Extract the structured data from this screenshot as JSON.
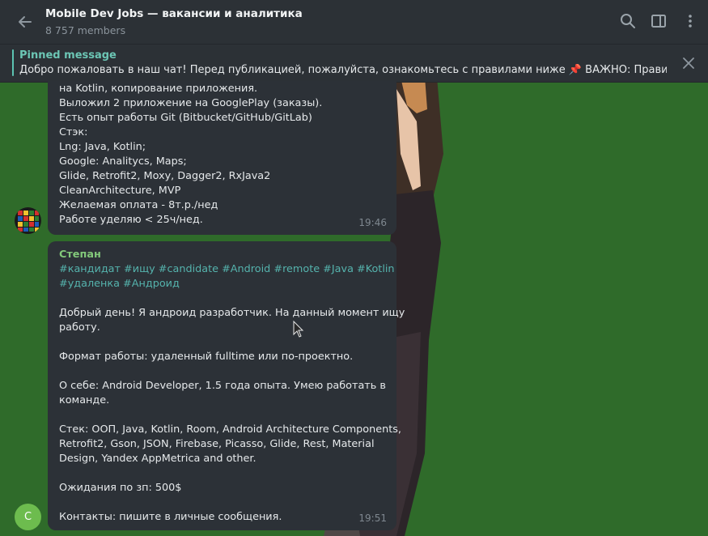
{
  "header": {
    "title": "Mobile Dev Jobs — вакансии и аналитика",
    "members": "8 757 members",
    "icons": [
      "back-arrow-icon",
      "search-icon",
      "sidebar-toggle-icon",
      "more-vertical-icon"
    ]
  },
  "pinned": {
    "label": "Pinned message",
    "text": "Добро пожаловать в наш чат! Перед публикацией, пожалуйста, ознакомьтесь с правилами ниже   📌 ВАЖНО: Правила пу..."
  },
  "messages": [
    {
      "lines": [
        "на Kotlin, копирование приложения.",
        "Выложил 2 приложение на GooglePlay (заказы).",
        "Есть опыт работы Git (Bitbucket/GitHub/GitLab)",
        "Стэк:",
        "Lng: Java, Kotlin;",
        "Google: Analitycs, Maps;",
        "Glide, Retrofit2, Moxy, Dagger2, RxJava2",
        "CleanArchitecture, MVP",
        "Желаемая оплата - 8т.р./нед",
        "Работе уделяю < 25ч/нед."
      ],
      "time": "19:46"
    },
    {
      "sender": "Степан",
      "avatar_letter": "С",
      "hashtags_line1": "#кандидат #ищу #candidate #Android #remote #Java #Kotlin",
      "hashtags_line2": "#удаленка #Андроид",
      "lines": [
        "",
        "Добрый день! Я андроид разработчик. На данный момент ищу",
        "работу.",
        "",
        "Формат работы: удаленный fulltime или по-проектно.",
        "",
        "О себе: Android Developer, 1.5 года опыта. Умею работать в",
        "команде.",
        "",
        "Стек: ООП, Java, Kotlin, Room, Android Architecture Components,",
        "Retrofit2, Gson, JSON, Firebase, Picasso, Glide, Rest, Material",
        "Design, Yandex AppMetrica and other.",
        "",
        "Ожидания по зп: 500$",
        "",
        "Контакты: пишите в личные сообщения."
      ],
      "time": "19:51"
    }
  ],
  "colors": {
    "background": "#2f6b2a",
    "panel": "#2c3136",
    "accent": "#5cc3b2",
    "sender": "#82c87a",
    "hashtag": "#55b3ad"
  }
}
